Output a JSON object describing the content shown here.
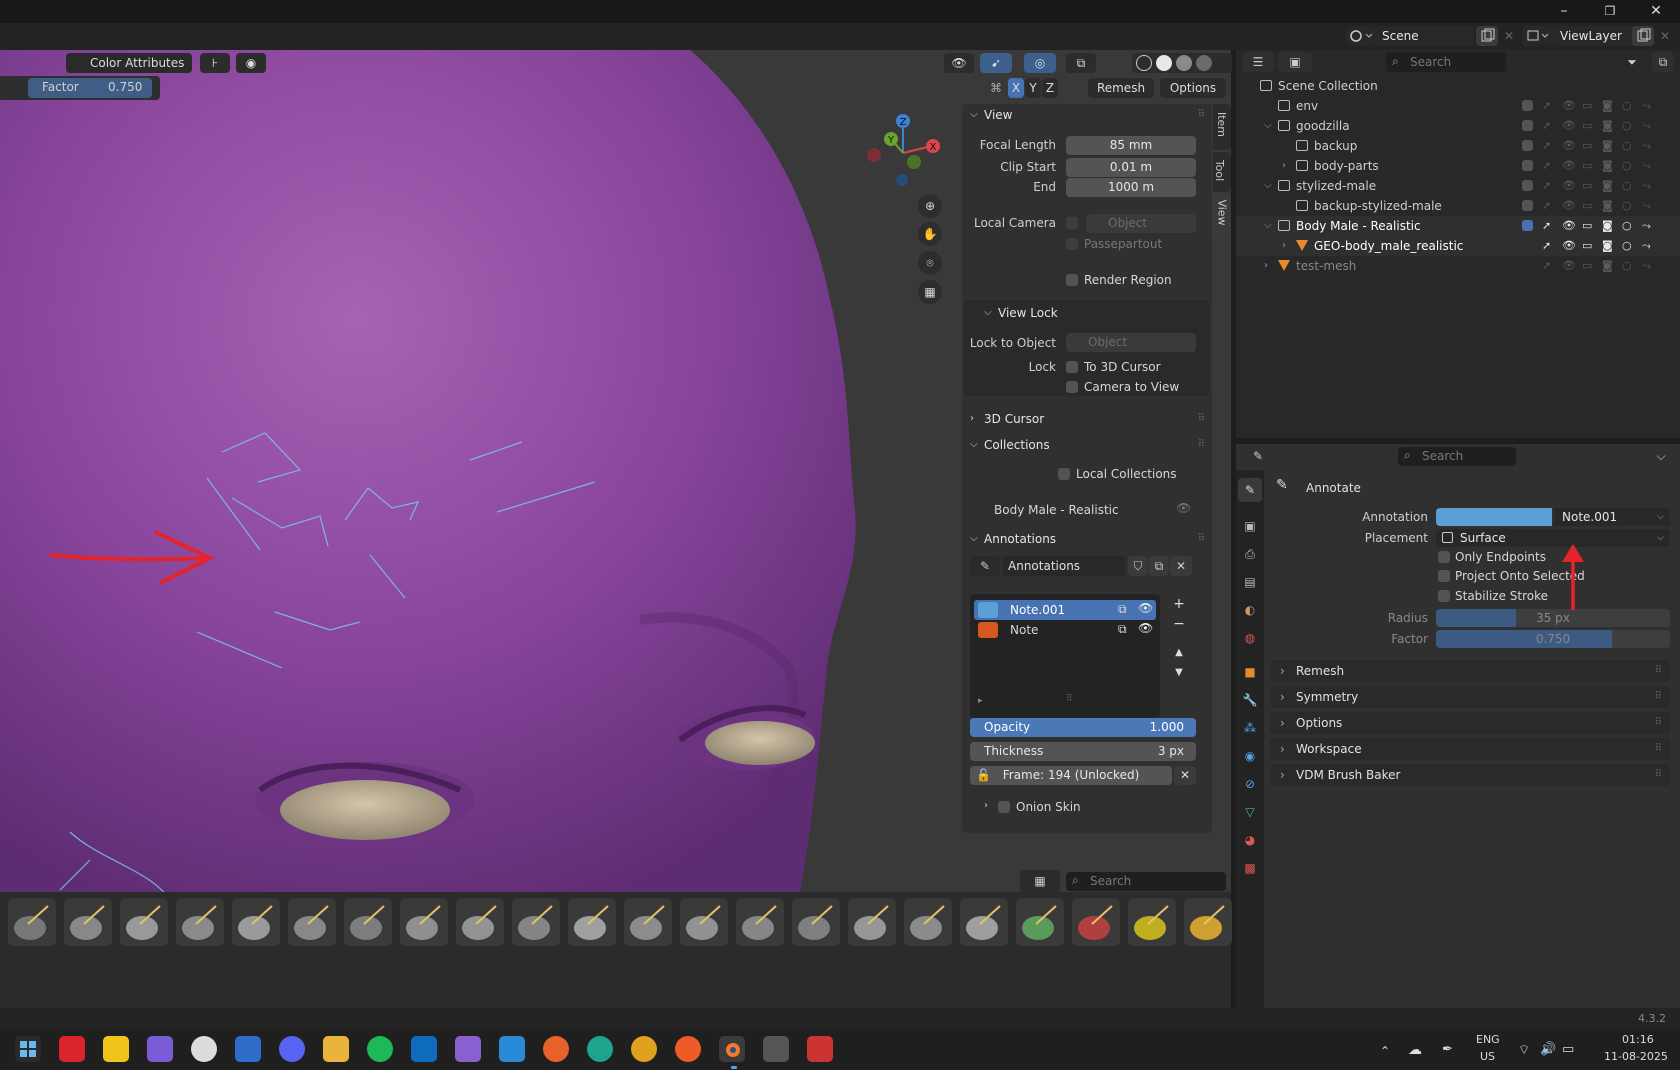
{
  "titlebar": {
    "minimize": "–",
    "maximize": "❐",
    "close": "✕"
  },
  "topbar": {
    "scene": "Scene",
    "view_layer": "ViewLayer",
    "outliner_search_placeholder": "Search"
  },
  "viewport_header": {
    "color_attributes": "Color Attributes",
    "factor_label": "Factor",
    "factor_value": "0.750",
    "axis_x": "X",
    "axis_y": "Y",
    "axis_z": "Z",
    "remesh": "Remesh",
    "options": "Options"
  },
  "gizmo": {
    "x": "X",
    "y": "Y",
    "z": "Z"
  },
  "npanel": {
    "tabs": [
      "Item",
      "Tool",
      "View"
    ],
    "view": {
      "title": "View",
      "focal_length_label": "Focal Length",
      "focal_length": "85 mm",
      "clip_start_label": "Clip Start",
      "clip_start": "0.01 m",
      "end_label": "End",
      "end": "1000 m",
      "local_camera_label": "Local Camera",
      "object_placeholder": "Object",
      "passepartout": "Passepartout",
      "render_region": "Render Region"
    },
    "view_lock": {
      "title": "View Lock",
      "lock_to_object_label": "Lock to Object",
      "object_placeholder": "Object",
      "lock_label": "Lock",
      "to_3d_cursor": "To 3D Cursor",
      "camera_to_view": "Camera to View"
    },
    "cursor_3d": {
      "title": "3D Cursor"
    },
    "collections": {
      "title": "Collections",
      "local_collections": "Local Collections",
      "item": "Body Male - Realistic"
    },
    "annotations": {
      "title": "Annotations",
      "datablock": "Annotations",
      "layers": [
        {
          "name": "Note.001",
          "color": "#5aa0d6",
          "selected": true
        },
        {
          "name": "Note",
          "color": "#d5581d",
          "selected": false
        }
      ],
      "opacity_label": "Opacity",
      "opacity": "1.000",
      "opacity_fraction": 1.0,
      "thickness_label": "Thickness",
      "thickness": "3 px",
      "frame": "Frame: 194 (Unlocked)",
      "onion_skin": "Onion Skin"
    }
  },
  "toolshelf": {
    "search_placeholder": "Search",
    "brush_count": 22
  },
  "outliner": {
    "search_placeholder": "Search",
    "rows": [
      {
        "label": "Scene Collection",
        "indent": 0,
        "icon": "scene-collection-icon"
      },
      {
        "label": "env",
        "indent": 1,
        "icon": "collection-icon"
      },
      {
        "label": "goodzilla",
        "indent": 1,
        "icon": "collection-icon",
        "expanded": true
      },
      {
        "label": "backup",
        "indent": 2,
        "icon": "collection-icon"
      },
      {
        "label": "body-parts",
        "indent": 2,
        "icon": "collection-icon",
        "expandable": true
      },
      {
        "label": "stylized-male",
        "indent": 1,
        "icon": "collection-icon",
        "expanded": true
      },
      {
        "label": "backup-stylized-male",
        "indent": 2,
        "icon": "collection-icon"
      },
      {
        "label": "Body Male - Realistic",
        "indent": 1,
        "icon": "collection-icon",
        "expanded": true,
        "active": true
      },
      {
        "label": "GEO-body_male_realistic",
        "indent": 2,
        "icon": "mesh-icon",
        "expandable": true,
        "active": true
      },
      {
        "label": "test-mesh",
        "indent": 1,
        "icon": "mesh-icon",
        "expandable": true
      }
    ]
  },
  "properties": {
    "search_placeholder": "Search",
    "tool_name": "Annotate",
    "annotation_label": "Annotation",
    "annotation_value": "Note.001",
    "annotation_color": "#5aa0d6",
    "placement_label": "Placement",
    "placement_value": "Surface",
    "only_endpoints": "Only Endpoints",
    "project_onto_selected": "Project Onto Selected",
    "stabilize_stroke": "Stabilize Stroke",
    "radius_label": "Radius",
    "radius_value": "35 px",
    "radius_fraction": 0.34,
    "factor_label": "Factor",
    "factor_value": "0.750",
    "factor_fraction": 0.75,
    "panels": [
      "Remesh",
      "Symmetry",
      "Options",
      "Workspace",
      "VDM Brush Baker"
    ]
  },
  "statusbar": {
    "version": "4.3.2"
  },
  "taskbar": {
    "lang": "ENG",
    "region": "US",
    "time": "01:16",
    "date": "11-08-2025"
  }
}
